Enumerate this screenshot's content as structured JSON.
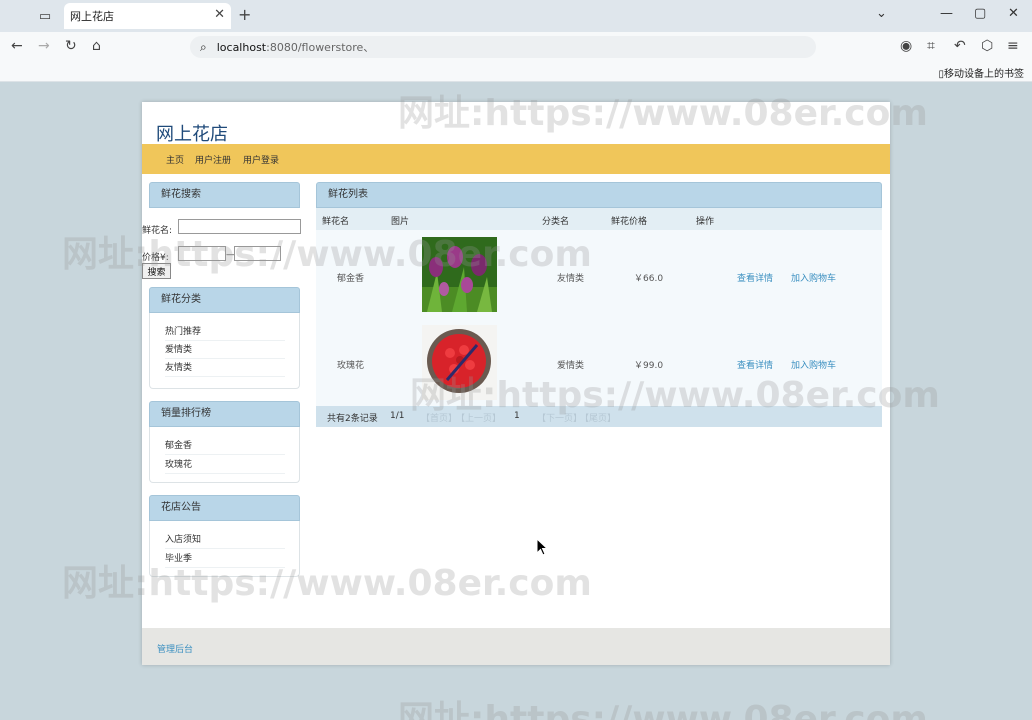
{
  "browser": {
    "tab_title": "网上花店",
    "tab_close": "✕",
    "new_tab": "+",
    "url_host": "localhost",
    "url_path": ":8080/flowerstore、",
    "bookmark_mobile": "移动设备上的书签"
  },
  "site": {
    "title": "网上花店",
    "menu": [
      "主页",
      "用户注册",
      "用户登录"
    ]
  },
  "search": {
    "header": "鲜花搜索",
    "name_label": "鲜花名:",
    "price_label": "价格¥:",
    "range_sep": "—",
    "button": "搜索"
  },
  "category": {
    "header": "鲜花分类",
    "items": [
      "热门推荐",
      "爱情类",
      "友情类"
    ]
  },
  "ranking": {
    "header": "销量排行榜",
    "items": [
      "郁金香",
      "玫瑰花"
    ]
  },
  "notice": {
    "header": "花店公告",
    "items": [
      "入店须知",
      "毕业季"
    ]
  },
  "flower_list": {
    "header": "鲜花列表",
    "columns": [
      "鲜花名",
      "图片",
      "分类名",
      "鲜花价格",
      "操作"
    ],
    "rows": [
      {
        "name": "郁金香",
        "category": "友情类",
        "price": "￥66.0",
        "detail": "查看详情",
        "add_cart": "加入购物车"
      },
      {
        "name": "玫瑰花",
        "category": "爱情类",
        "price": "￥99.0",
        "detail": "查看详情",
        "add_cart": "加入购物车"
      }
    ],
    "pager": {
      "total": "共有2条记录",
      "page": "1/1",
      "first": "【首页】",
      "prev": "【上一页】",
      "current": "1",
      "next": "【下一页】",
      "last": "【尾页】"
    }
  },
  "footer": {
    "admin_link": "管理后台"
  },
  "watermark": "网址:https://www.08er.com",
  "colors": {
    "menu_bar": "#f0c65a",
    "box_header": "#b9d6e8",
    "link": "#3a8fc0",
    "title": "#1f4a7a"
  }
}
